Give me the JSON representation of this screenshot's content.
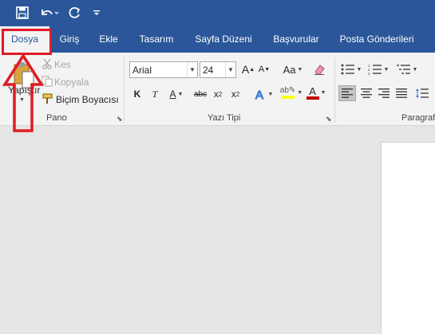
{
  "quick_access": {
    "icons": [
      "save-icon",
      "undo-icon",
      "redo-icon",
      "customize-icon"
    ]
  },
  "tabs": [
    {
      "label": "Dosya"
    },
    {
      "label": "Giriş"
    },
    {
      "label": "Ekle"
    },
    {
      "label": "Tasarım"
    },
    {
      "label": "Sayfa Düzeni"
    },
    {
      "label": "Başvurular"
    },
    {
      "label": "Posta Gönderileri"
    }
  ],
  "clipboard": {
    "paste_label": "Yapıştır",
    "cut_label": "Kes",
    "copy_label": "Kopyala",
    "format_painter_label": "Biçim Boyacısı",
    "group_label": "Pano"
  },
  "font": {
    "font_name": "Arial",
    "font_size": "24",
    "group_label": "Yazı Tipi",
    "bold": "K",
    "italic": "T",
    "underline": "A",
    "strike": "abc",
    "subscript": "x",
    "superscript": "x",
    "change_case": "Aa",
    "grow": "A",
    "shrink": "A"
  },
  "paragraph": {
    "group_label": "Paragraf"
  },
  "colors": {
    "brand": "#2b579a",
    "annotation": "#e01b24",
    "highlight": "#ffff00",
    "font_color": "#c00000"
  }
}
